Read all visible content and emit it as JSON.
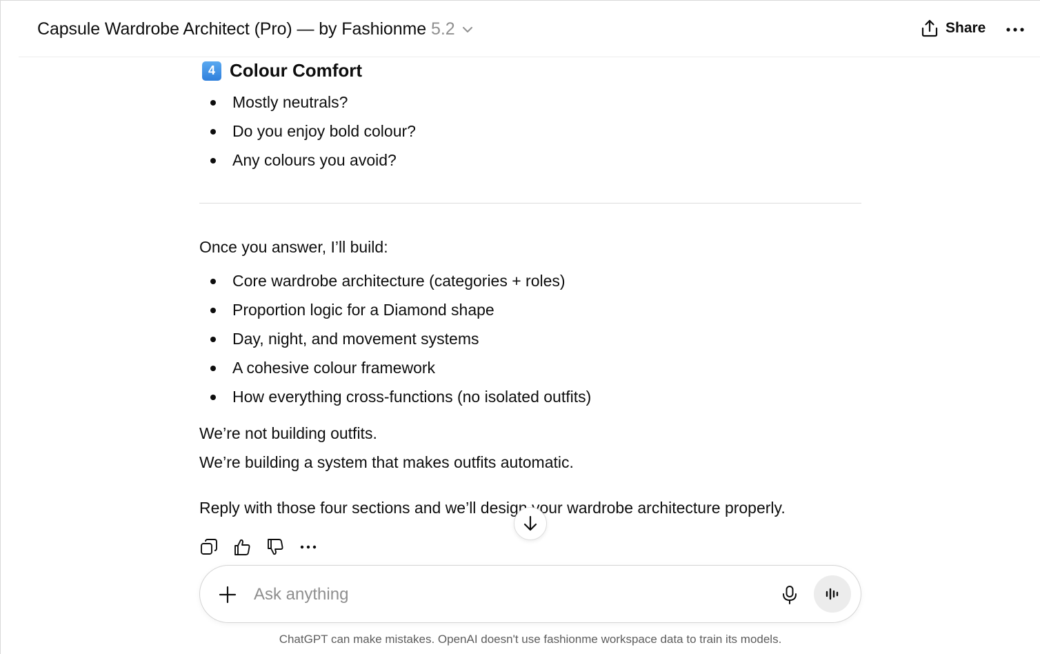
{
  "header": {
    "title": "Capsule Wardrobe Architect (Pro) — by Fashionme",
    "version": "5.2",
    "share_label": "Share"
  },
  "section4": {
    "badge": "4",
    "heading": "Colour Comfort",
    "items": [
      "Mostly neutrals?",
      "Do you enjoy bold colour?",
      "Any colours you avoid?"
    ]
  },
  "message": {
    "intro": "Once you answer, I’ll build:",
    "build_items": [
      "Core wardrobe architecture (categories + roles)",
      "Proportion logic for a Diamond shape",
      "Day, night, and movement systems",
      "A cohesive colour framework",
      "How everything cross-functions (no isolated outfits)"
    ],
    "line1": "We’re not building outfits.",
    "line2": "We’re building a system that makes outfits automatic.",
    "closing": "Reply with those four sections and we’ll design your wardrobe architecture properly."
  },
  "composer": {
    "placeholder": "Ask anything"
  },
  "footer": {
    "disclaimer": "ChatGPT can make mistakes. OpenAI doesn't use fashionme workspace data to train its models."
  },
  "icons": {
    "share": "share-icon",
    "more": "more-icon",
    "copy": "copy-icon",
    "thumbs_up": "thumbs-up-icon",
    "thumbs_down": "thumbs-down-icon",
    "plus": "plus-icon",
    "mic": "mic-icon",
    "voice": "voice-mode-icon",
    "scroll": "arrow-down-icon"
  }
}
